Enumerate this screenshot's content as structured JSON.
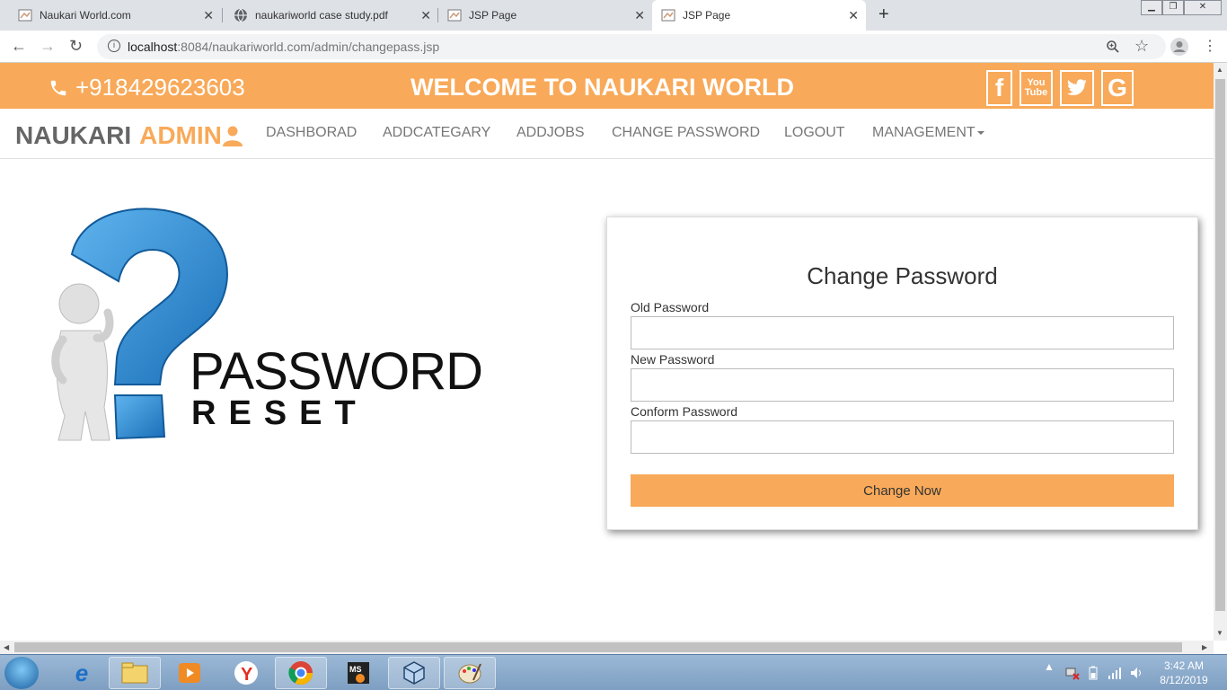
{
  "browser": {
    "tabs": [
      {
        "title": "Naukari World.com",
        "active": false
      },
      {
        "title": "naukariworld case study.pdf",
        "active": false
      },
      {
        "title": "JSP Page",
        "active": false
      },
      {
        "title": "JSP Page",
        "active": true
      }
    ],
    "url_host": "localhost",
    "url_rest": ":8084/naukariworld.com/admin/changepass.jsp"
  },
  "topbar": {
    "phone": "+918429623603",
    "welcome": "WELCOME TO NAUKARI WORLD",
    "social": [
      "facebook-icon",
      "youtube-icon",
      "twitter-icon",
      "google-icon"
    ]
  },
  "navbar": {
    "brand_main": "NAUKARI",
    "brand_accent": "ADMIN",
    "links": [
      "DASHBORAD",
      "ADDCATEGARY",
      "ADDJOBS",
      "CHANGE PASSWORD",
      "LOGOUT",
      "MANAGEMENT"
    ]
  },
  "hero": {
    "word1": "PASSWORD",
    "word2": "RESET"
  },
  "form": {
    "title": "Change Password",
    "old_label": "Old Password",
    "new_label": "New Password",
    "confirm_label": "Conform Password",
    "submit": "Change Now"
  },
  "taskbar": {
    "time": "3:42 AM",
    "date": "8/12/2019"
  },
  "colors": {
    "accent": "#f8a959"
  }
}
